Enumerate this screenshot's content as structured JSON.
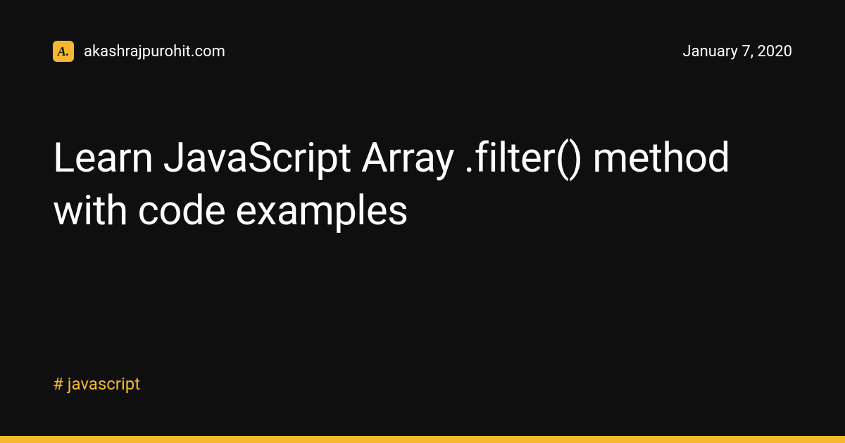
{
  "header": {
    "logo_text": "A.",
    "domain": "akashrajpurohit.com",
    "date": "January 7, 2020"
  },
  "title": "Learn JavaScript Array .filter() method with code examples",
  "tags": [
    "# javascript"
  ],
  "colors": {
    "background": "#0f0f0f",
    "accent": "#f5b82e",
    "text": "#ffffff"
  }
}
